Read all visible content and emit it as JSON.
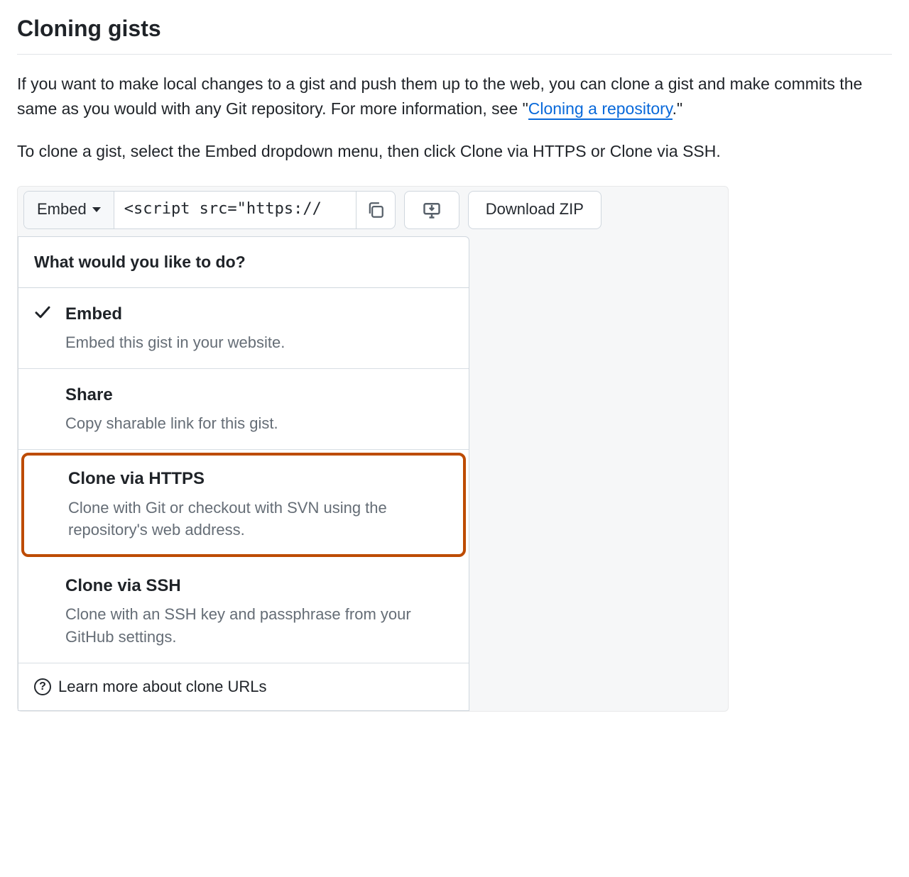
{
  "heading": "Cloning gists",
  "para1": {
    "pre": "If you want to make local changes to a gist and push them up to the web, you can clone a gist and make commits the same as you would with any Git repository. For more information, see \"",
    "link": "Cloning a repository",
    "post": ".\""
  },
  "para2": "To clone a gist, select the Embed dropdown menu, then click Clone via HTTPS or Clone via SSH.",
  "toolbar": {
    "embed_label": "Embed",
    "embed_url": "<script src=\"https://",
    "download_label": "Download ZIP"
  },
  "dropdown": {
    "header": "What would you like to do?",
    "items": [
      {
        "title": "Embed",
        "desc": "Embed this gist in your website.",
        "checked": true
      },
      {
        "title": "Share",
        "desc": "Copy sharable link for this gist."
      },
      {
        "title": "Clone via HTTPS",
        "desc": "Clone with Git or checkout with SVN using the repository's web address.",
        "highlighted": true
      },
      {
        "title": "Clone via SSH",
        "desc": "Clone with an SSH key and passphrase from your GitHub settings."
      }
    ],
    "footer": "Learn more about clone URLs"
  }
}
